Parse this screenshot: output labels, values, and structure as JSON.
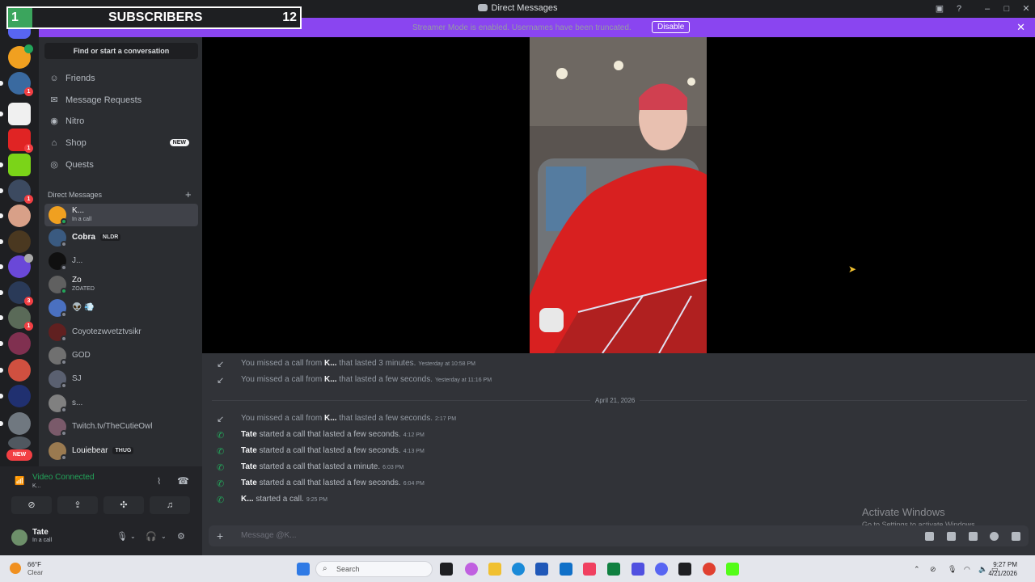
{
  "window": {
    "title": "Direct Messages"
  },
  "overlay": {
    "subs_number": "1",
    "subs_label": "SUBSCRIBERS",
    "subs_count": "12"
  },
  "banner": {
    "text": "Streamer Mode is enabled. Usernames have been truncated.",
    "disable_label": "Disable"
  },
  "sidebar": {
    "find_label": "Find or start a conversation",
    "nav": [
      {
        "label": "Friends",
        "icon": "friends-icon"
      },
      {
        "label": "Message Requests",
        "icon": "mail-icon"
      },
      {
        "label": "Nitro",
        "icon": "nitro-icon"
      },
      {
        "label": "Shop",
        "icon": "shop-icon",
        "badge": "NEW"
      },
      {
        "label": "Quests",
        "icon": "quests-icon"
      }
    ],
    "dm_header": "Direct Messages",
    "dms": [
      {
        "name": "K...",
        "status": "In a call",
        "active": true
      },
      {
        "name": "Cobra",
        "tag": "NLDR"
      },
      {
        "name": "J..."
      },
      {
        "name": "Zo",
        "status": "ZOATED"
      },
      {
        "name": "👽 💨"
      },
      {
        "name": "Coyotezwvetztvsikr"
      },
      {
        "name": "GOD"
      },
      {
        "name": "SJ"
      },
      {
        "name": "s..."
      },
      {
        "name": "Twitch.tv/TheCutieOwl"
      },
      {
        "name": "Louiebear",
        "tag": "THUG"
      }
    ],
    "rail_new_label": "NEW"
  },
  "voice": {
    "status": "Video Connected",
    "channel": "K..."
  },
  "user": {
    "name": "Tate",
    "status": "In a call"
  },
  "chat": {
    "missed": [
      {
        "who": "K...",
        "text_pre": "You missed a call from ",
        "text_post": " that lasted 3 minutes.",
        "ts": "Yesterday at 10:58 PM"
      },
      {
        "who": "K...",
        "text_pre": "You missed a call from ",
        "text_post": " that lasted a few seconds.",
        "ts": "Yesterday at 11:16 PM"
      }
    ],
    "date_divider": "April 21, 2026",
    "today": [
      {
        "type": "missed",
        "pre": "You missed a call from ",
        "who": "K...",
        "post": " that lasted a few seconds.",
        "ts": "2:17 PM"
      },
      {
        "type": "start",
        "pre": "",
        "who": "Tate",
        "post": " started a call that lasted a few seconds.",
        "ts": "4:12 PM"
      },
      {
        "type": "start",
        "pre": "",
        "who": "Tate",
        "post": " started a call that lasted a few seconds.",
        "ts": "4:13 PM"
      },
      {
        "type": "start",
        "pre": "",
        "who": "Tate",
        "post": " started a call that lasted a minute.",
        "ts": "6:03 PM"
      },
      {
        "type": "start",
        "pre": "",
        "who": "Tate",
        "post": " started a call that lasted a few seconds.",
        "ts": "6:04 PM"
      },
      {
        "type": "start",
        "pre": "",
        "who": "K...",
        "post": " started a call.",
        "ts": "9:25 PM"
      }
    ],
    "input_placeholder": "Message @K..."
  },
  "activate": {
    "line1": "Activate Windows",
    "line2": "Go to Settings to activate Windows."
  },
  "taskbar": {
    "temp": "66°F",
    "cond": "Clear",
    "search": "Search",
    "time": "9:27 PM",
    "date": "4/21/2026"
  },
  "colors": {
    "accent": "#8a45f0",
    "green": "#23a55a",
    "red": "#f23f43"
  }
}
